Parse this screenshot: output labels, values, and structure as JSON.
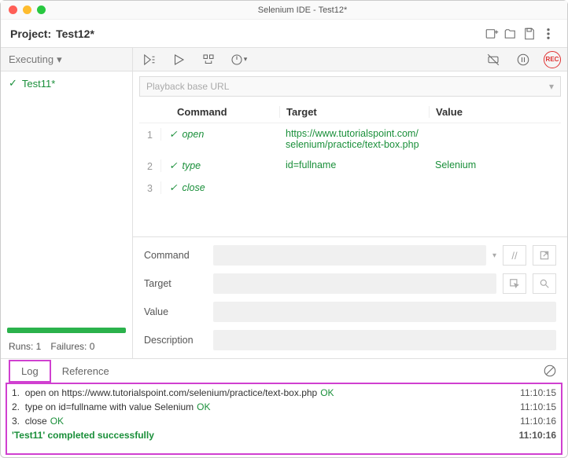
{
  "window": {
    "title": "Selenium IDE - Test12*"
  },
  "project": {
    "label": "Project:",
    "name": "Test12*"
  },
  "sidebar": {
    "executing_label": "Executing",
    "tests": [
      {
        "name": "Test11*"
      }
    ],
    "runs_label": "Runs: 1",
    "failures_label": "Failures: 0"
  },
  "urlbar": {
    "placeholder": "Playback base URL"
  },
  "table": {
    "headers": {
      "command": "Command",
      "target": "Target",
      "value": "Value"
    },
    "rows": [
      {
        "n": "1",
        "command": "open",
        "target": "https://www.tutorialspoint.com/selenium/practice/text-box.php",
        "value": ""
      },
      {
        "n": "2",
        "command": "type",
        "target": "id=fullname",
        "value": "Selenium"
      },
      {
        "n": "3",
        "command": "close",
        "target": "",
        "value": ""
      }
    ]
  },
  "editor": {
    "command_label": "Command",
    "target_label": "Target",
    "value_label": "Value",
    "description_label": "Description"
  },
  "tabs": {
    "log": "Log",
    "reference": "Reference"
  },
  "log": {
    "lines": [
      {
        "n": "1.",
        "text": "open on https://www.tutorialspoint.com/selenium/practice/text-box.php",
        "status": "OK",
        "time": "11:10:15"
      },
      {
        "n": "2.",
        "text": "type on id=fullname with value Selenium",
        "status": "OK",
        "time": "11:10:15"
      },
      {
        "n": "3.",
        "text": "close",
        "status": "OK",
        "time": "11:10:16"
      }
    ],
    "success": {
      "text": "'Test11' completed successfully",
      "time": "11:10:16"
    }
  }
}
